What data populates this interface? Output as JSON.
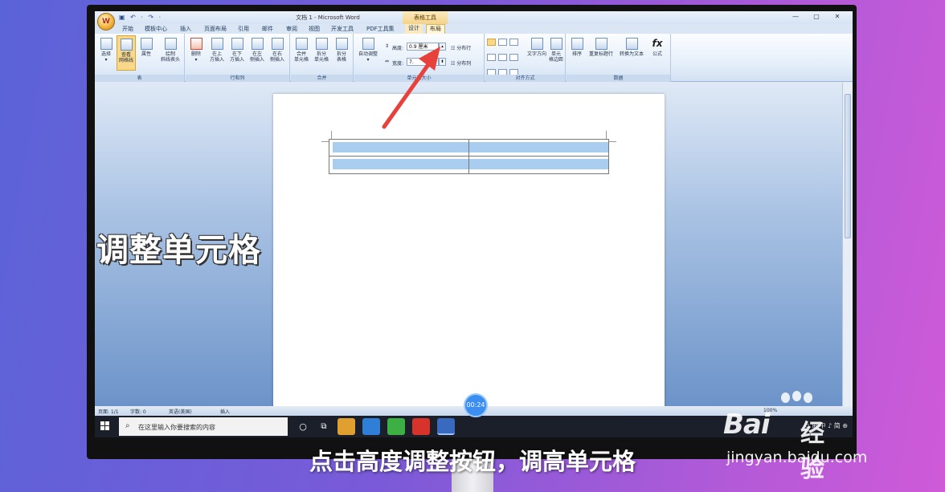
{
  "window": {
    "title": "文档 1 - Microsoft Word",
    "context_tool": "表格工具",
    "office_button_glyph": "W",
    "quick_access": "▣ ↶ · ↷ ·",
    "controls": [
      "—",
      "▢",
      "✕"
    ]
  },
  "tabs": [
    "开始",
    "模板中心",
    "插入",
    "页面布局",
    "引用",
    "邮件",
    "审阅",
    "视图",
    "开发工具",
    "PDF工具集",
    "设计",
    "布局"
  ],
  "active_tab": "布局",
  "ribbon": {
    "table_group": {
      "label": "表",
      "buttons": [
        {
          "label": "选择",
          "sub": "▾"
        },
        {
          "label": "查看",
          "sub": "网格线"
        },
        {
          "label": "属性",
          "sub": ""
        },
        {
          "label": "绘制",
          "sub": "斜线表头"
        }
      ]
    },
    "rows_cols_group": {
      "label": "行和列",
      "buttons": [
        {
          "label": "删除",
          "sub": "▾"
        },
        {
          "label": "在上",
          "sub": "方插入"
        },
        {
          "label": "在下",
          "sub": "方插入"
        },
        {
          "label": "在左",
          "sub": "侧插入"
        },
        {
          "label": "在右",
          "sub": "侧插入"
        }
      ]
    },
    "merge_group": {
      "label": "合并",
      "buttons": [
        {
          "label": "合并",
          "sub": "单元格"
        },
        {
          "label": "拆分",
          "sub": "单元格"
        },
        {
          "label": "拆分",
          "sub": "表格"
        }
      ]
    },
    "cell_size_group": {
      "label": "单元格大小",
      "autofit_label": "自动调整",
      "autofit_sub": "▾",
      "height_label": "高度:",
      "height_value": "0.9 厘米",
      "width_label": "宽度:",
      "width_value": "7.",
      "distribute_rows": "分布行",
      "distribute_cols": "分布列"
    },
    "alignment_group": {
      "label": "对齐方式",
      "text_direction": "文字方向",
      "cell_margins_1": "单元",
      "cell_margins_2": "格边距"
    },
    "data_group": {
      "label": "数据",
      "buttons": [
        {
          "label": "排序",
          "sub": ""
        },
        {
          "label": "重复标题行",
          "sub": ""
        },
        {
          "label": "转换为文本",
          "sub": ""
        },
        {
          "label": "公式",
          "sub": ""
        }
      ]
    }
  },
  "status_bar": {
    "page": "页面: 1/1",
    "words": "字数: 0",
    "language": "英语(美国)",
    "insert": "插入",
    "zoom": "100%"
  },
  "taskbar": {
    "search_placeholder": "在这里输入你要搜索的内容",
    "tray": "⊂ ⊞ 中 ♪ 简 ⊕"
  },
  "overlay": {
    "title": "调整单元格",
    "caption": "点击高度调整按钮，调高单元格",
    "timer": "00:24"
  },
  "watermark": {
    "logo": "Bai",
    "brand": "经验",
    "url": "jingyan.baidu.com"
  },
  "colors": {
    "background_start": "#5b63d8",
    "background_end": "#cf5ad8",
    "accent_arrow": "#e8413b",
    "table_band": "#a9cdee",
    "selected_button": "#f9d889"
  }
}
